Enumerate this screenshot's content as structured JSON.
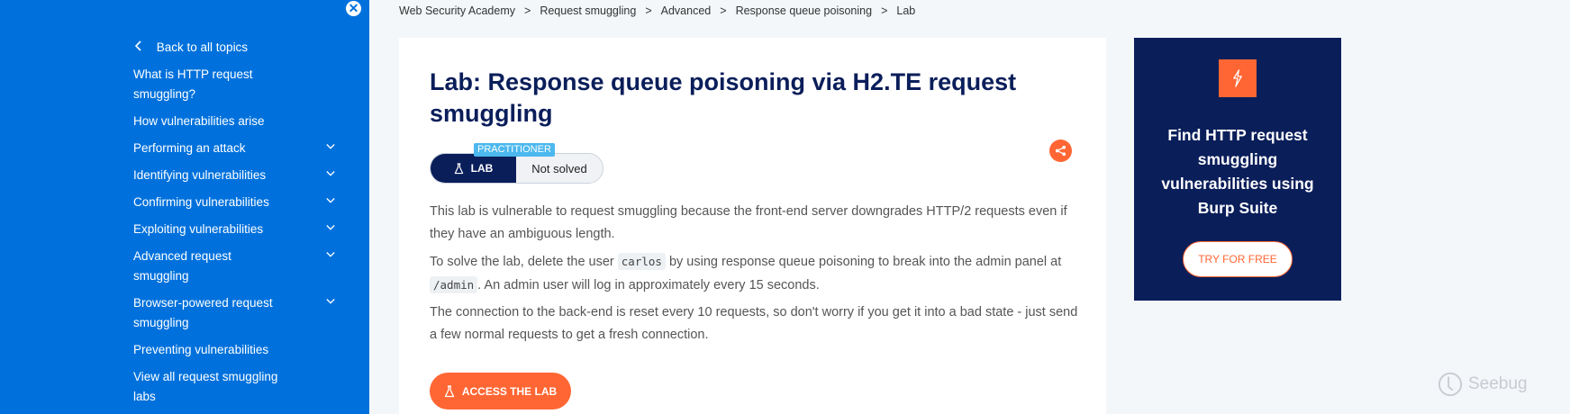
{
  "sidebar": {
    "back_label": "Back to all topics",
    "items": [
      {
        "label": "What is HTTP request smuggling?",
        "expandable": false
      },
      {
        "label": "How vulnerabilities arise",
        "expandable": false
      },
      {
        "label": "Performing an attack",
        "expandable": true
      },
      {
        "label": "Identifying vulnerabilities",
        "expandable": true
      },
      {
        "label": "Confirming vulnerabilities",
        "expandable": true
      },
      {
        "label": "Exploiting vulnerabilities",
        "expandable": true
      },
      {
        "label": "Advanced request smuggling",
        "expandable": true
      },
      {
        "label": "Browser-powered request smuggling",
        "expandable": true
      },
      {
        "label": "Preventing vulnerabilities",
        "expandable": false
      },
      {
        "label": "View all request smuggling labs",
        "expandable": false
      }
    ]
  },
  "breadcrumb": [
    "Web Security Academy",
    "Request smuggling",
    "Advanced",
    "Response queue poisoning",
    "Lab"
  ],
  "lab": {
    "title": "Lab: Response queue poisoning via H2.TE request smuggling",
    "level": "PRACTITIONER",
    "badge_label": "LAB",
    "status": "Not solved",
    "desc_p1": "This lab is vulnerable to request smuggling because the front-end server downgrades HTTP/2 requests even if they have an ambiguous length.",
    "desc_p2_a": "To solve the lab, delete the user",
    "desc_p2_code1": "carlos",
    "desc_p2_b": "by using response queue poisoning to break into the admin panel at",
    "desc_p2_code2": "/admin",
    "desc_p2_c": ". An admin user will log in approximately every 15 seconds.",
    "desc_p3": "The connection to the back-end is reset every 10 requests, so don't worry if you get it into a bad state - just send a few normal requests to get a fresh connection.",
    "access_label": "ACCESS THE LAB"
  },
  "promo": {
    "title": "Find HTTP request smuggling vulnerabilities using Burp Suite",
    "button_label": "TRY FOR FREE"
  },
  "watermark": "Seebug",
  "colors": {
    "sidebar": "#0071dc",
    "navy": "#0a1e5a",
    "accent": "#ff6633",
    "level_tag": "#4cb8ee"
  },
  "icons": [
    "close-icon",
    "chevron-left-icon",
    "chevron-down-icon",
    "flask-icon",
    "share-icon",
    "burp-logo-icon"
  ]
}
